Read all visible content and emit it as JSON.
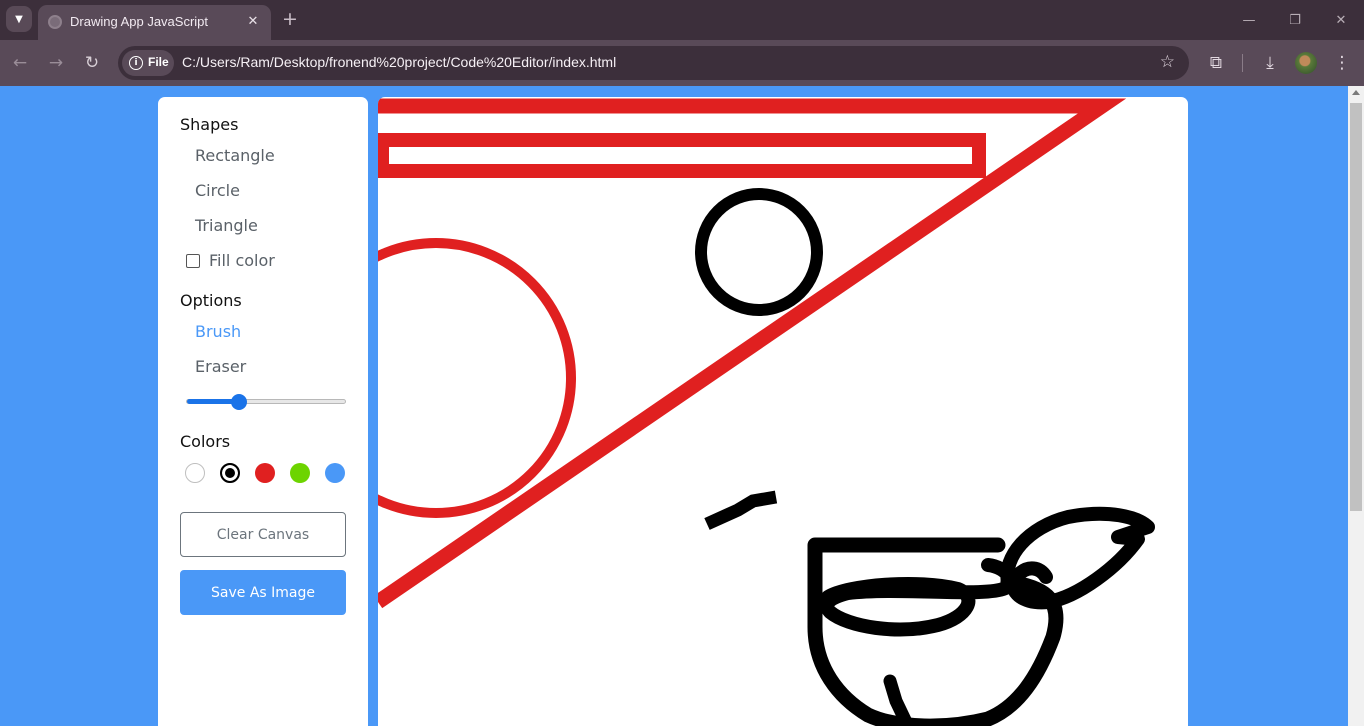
{
  "browser": {
    "tab_title": "Drawing App JavaScript",
    "url": "C:/Users/Ram/Desktop/fronend%20project/Code%20Editor/index.html",
    "file_chip_label": "File"
  },
  "tools": {
    "shapes_title": "Shapes",
    "shapes": [
      "Rectangle",
      "Circle",
      "Triangle"
    ],
    "fill_color_label": "Fill color",
    "fill_color_checked": false,
    "options_title": "Options",
    "options": [
      "Brush",
      "Eraser"
    ],
    "active_option": "Brush",
    "brush_size_fraction": 0.33,
    "colors_title": "Colors",
    "colors": [
      "#ffffff",
      "#000000",
      "#e02020",
      "#6dd400",
      "#4a98f7"
    ],
    "selected_color": "#000000",
    "clear_button": "Clear Canvas",
    "save_button": "Save As Image"
  }
}
